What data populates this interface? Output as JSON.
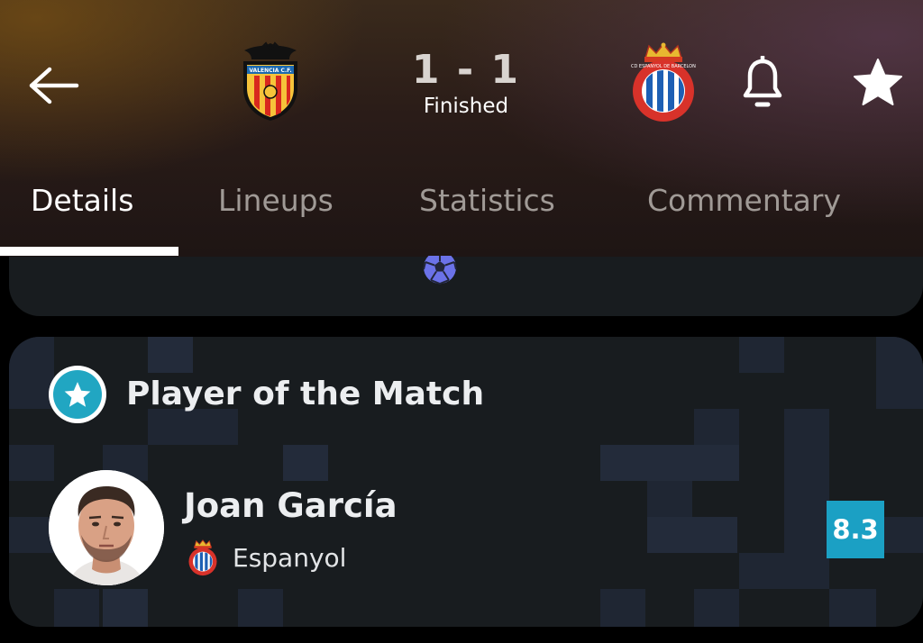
{
  "match": {
    "home_team": "Valencia",
    "home_crest_text": "VALENCIA C.F.",
    "away_team": "Espanyol",
    "away_crest_text": "RCD ESPANYOL DE BARCELONA",
    "score": "1 - 1",
    "status": "Finished"
  },
  "header": {
    "back_icon": "arrow-left-icon",
    "bell_icon": "bell-icon",
    "star_icon": "star-icon"
  },
  "tabs": [
    {
      "label": "Details",
      "active": true
    },
    {
      "label": "Lineups",
      "active": false
    },
    {
      "label": "Statistics",
      "active": false
    },
    {
      "label": "Commentary",
      "active": false
    }
  ],
  "events": {
    "icon": "soccer-ball-icon"
  },
  "potm": {
    "title": "Player of the Match",
    "badge_icon": "star-icon",
    "player_name": "Joan García",
    "team": "Espanyol",
    "rating": "8.3"
  },
  "colors": {
    "accent": "#1ba0c4",
    "card_bg": "#181c1f",
    "ball_icon": "#6b72e8"
  }
}
